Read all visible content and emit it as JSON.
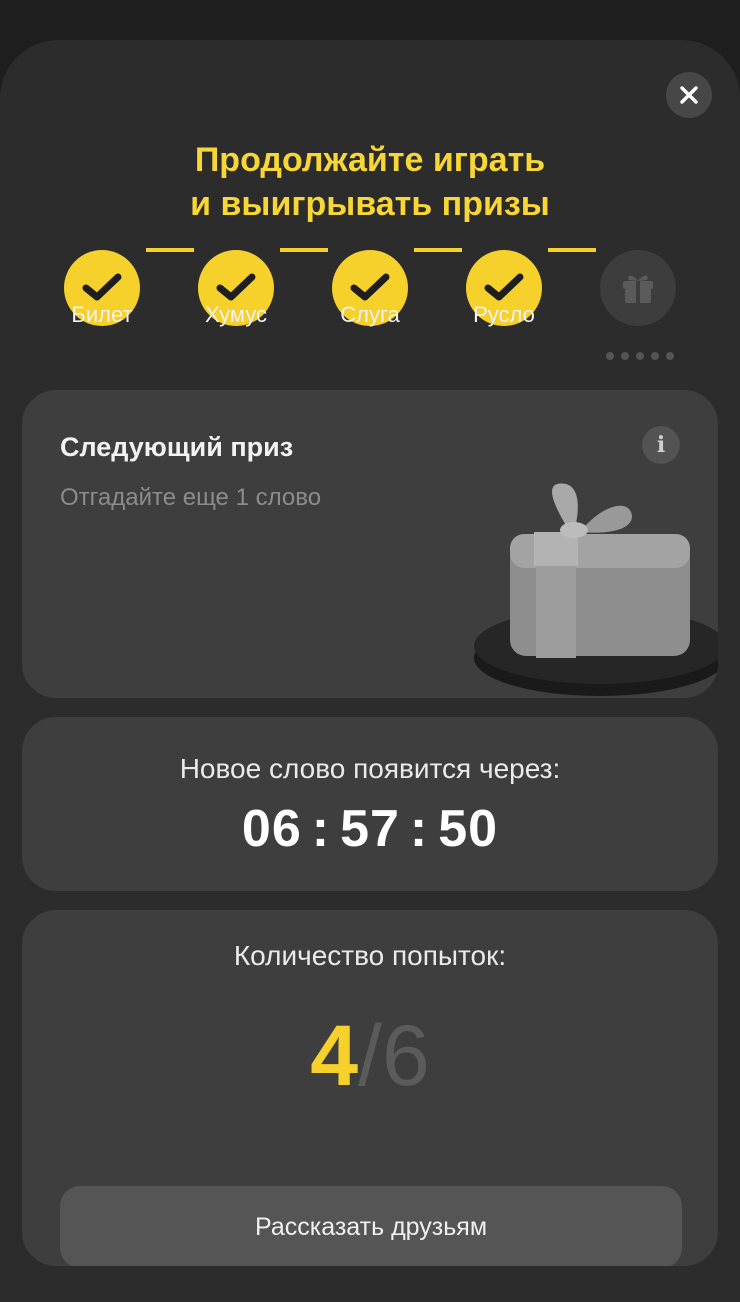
{
  "dialog": {
    "title_line1": "Продолжайте играть",
    "title_line2": "и выигрывать призы",
    "close_icon": "close-icon"
  },
  "progress": {
    "steps": [
      {
        "label": "Билет",
        "state": "completed"
      },
      {
        "label": "Хумус",
        "state": "completed"
      },
      {
        "label": "Слуга",
        "state": "completed"
      },
      {
        "label": "Русло",
        "state": "completed"
      },
      {
        "label": "",
        "state": "locked",
        "icon": "gift-icon"
      }
    ],
    "accent_color": "#f6d12b"
  },
  "next_prize": {
    "title": "Следующий приз",
    "subtitle": "Отгадайте еще 1 слово",
    "info_icon": "info-icon"
  },
  "timer": {
    "label": "Новое слово появится через:",
    "hours": "06",
    "minutes": "57",
    "seconds": "50",
    "separator": ":"
  },
  "attempts": {
    "label": "Количество попыток:",
    "used": "4",
    "slash": "/",
    "total": "6"
  },
  "share_button": {
    "label": "Рассказать друзьям"
  }
}
